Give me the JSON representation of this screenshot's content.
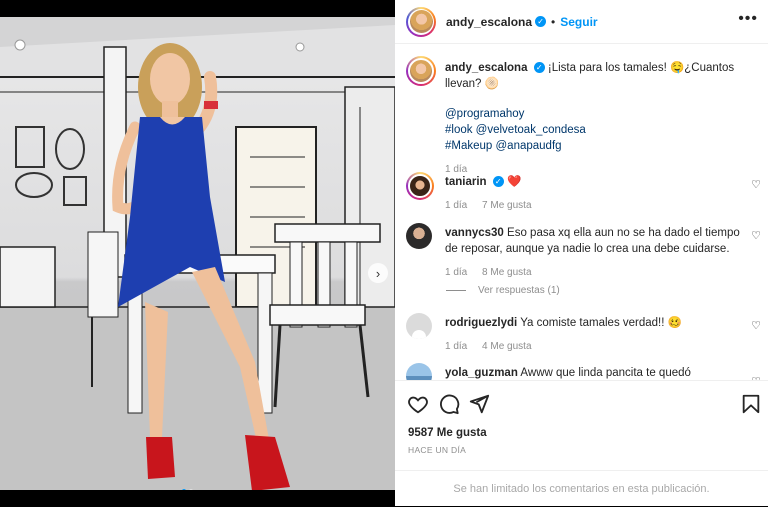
{
  "post": {
    "username": "andy_escalona",
    "follow_label": "Seguir",
    "separator": "•",
    "more_label": "•••"
  },
  "caption": {
    "username": "andy_escalona",
    "text": "¡Lista para los tamales! 🤤¿Cuantos llevan? 🫓",
    "line1": "@programahoy",
    "line2": "#look @velvetoak_condesa",
    "line3": "#Makeup @anapaudfg",
    "time": "1 día"
  },
  "comments": [
    {
      "username": "taniarin",
      "verified": true,
      "text": "❤️",
      "time": "1 día",
      "likes": "7 Me gusta"
    },
    {
      "username": "vannycs30",
      "text": "Eso pasa xq ella aun no se ha dado el tiempo de reposar, aunque ya nadie lo crea una debe cuidarse.",
      "time": "1 día",
      "likes": "8 Me gusta",
      "replies": "Ver respuestas (1)"
    },
    {
      "username": "rodriguezlydi",
      "text": "Ya comiste tamales verdad!! 🥴",
      "time": "1 día",
      "likes": "4 Me gusta"
    },
    {
      "username": "yola_guzman",
      "text": "Awww que linda pancita te quedó"
    }
  ],
  "footer": {
    "likes": "9587 Me gusta",
    "time_ago": "HACE UN DÍA",
    "limited_notice": "Se han limitado los comentarios en esta publicación."
  },
  "icons": [
    "verified-icon",
    "heart-icon",
    "comment-icon",
    "share-icon",
    "bookmark-icon",
    "next-arrow-icon"
  ],
  "colors": {
    "accent": "#0095f6",
    "mention": "#00376b",
    "dress": "#1e3fb0",
    "shoes": "#c8151c"
  }
}
